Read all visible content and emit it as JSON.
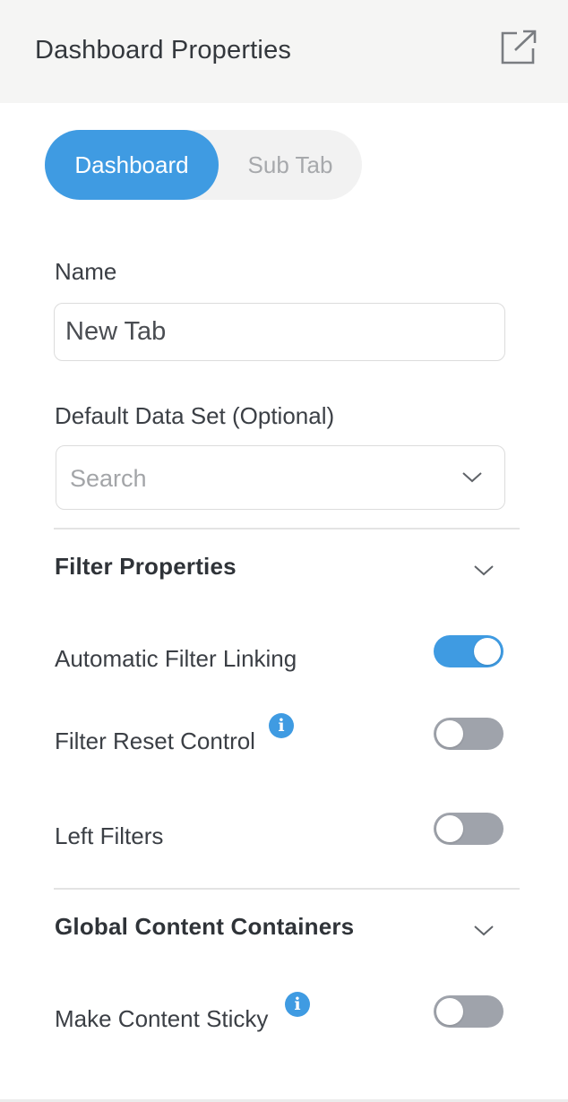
{
  "header": {
    "title": "Dashboard Properties",
    "popout_icon": "external-link-icon"
  },
  "tabs": [
    {
      "label": "Dashboard",
      "active": true
    },
    {
      "label": "Sub Tab",
      "active": false
    }
  ],
  "name_field": {
    "label": "Name",
    "value": "New Tab"
  },
  "data_set_field": {
    "label": "Default Data Set (Optional)",
    "placeholder": "Search",
    "chevron_icon": "chevron-down-icon"
  },
  "filter_section": {
    "title": "Filter Properties",
    "toggles": [
      {
        "label": "Automatic Filter Linking",
        "on": true,
        "info": false
      },
      {
        "label": "Filter Reset Control",
        "on": false,
        "info": true
      },
      {
        "label": "Left Filters",
        "on": false,
        "info": false
      }
    ]
  },
  "global_section": {
    "title": "Global Content Containers",
    "toggles": [
      {
        "label": "Make Content Sticky",
        "on": false,
        "info": true
      }
    ]
  },
  "info_icon_glyph": "i",
  "colors": {
    "accent": "#3f9be2",
    "toggle_off": "#9fa3ab",
    "header_bg": "#f5f5f4"
  }
}
